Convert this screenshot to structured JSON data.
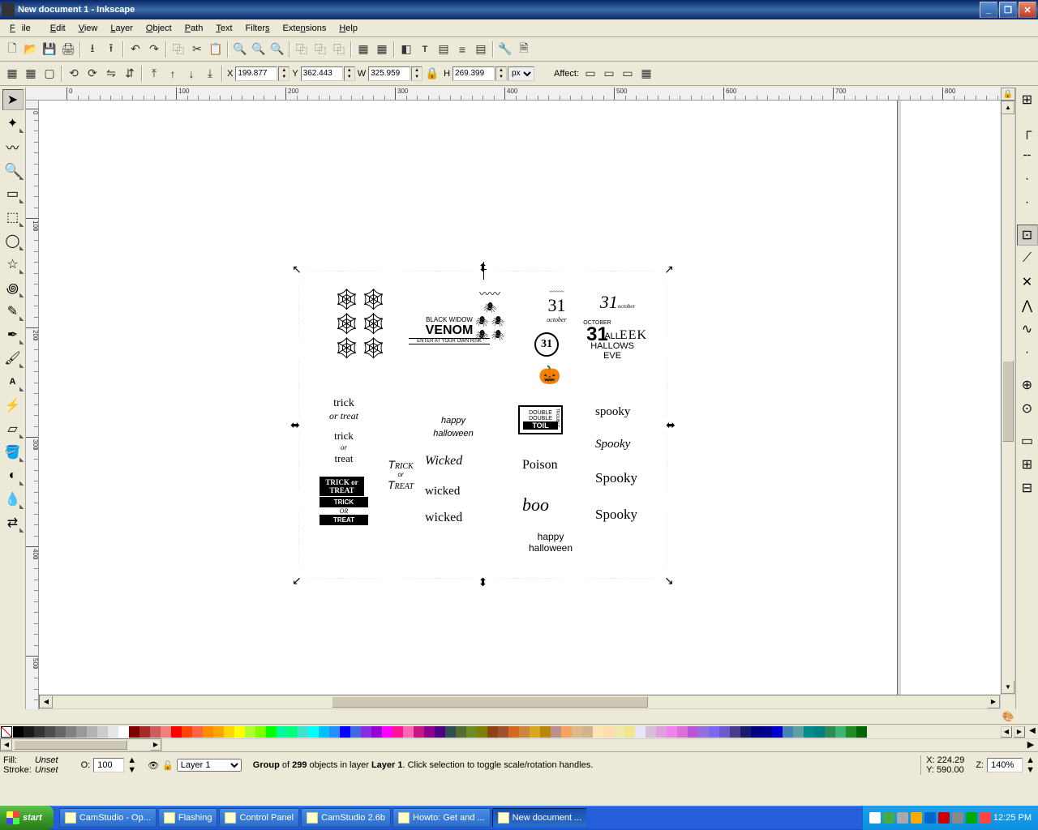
{
  "window": {
    "title": "New document 1 - Inkscape"
  },
  "menu": {
    "file": "File",
    "edit": "Edit",
    "view": "View",
    "layer": "Layer",
    "object": "Object",
    "path": "Path",
    "text": "Text",
    "filters": "Filters",
    "extensions": "Extensions",
    "help": "Help"
  },
  "coords": {
    "x_label": "X",
    "x": "199.877",
    "y_label": "Y",
    "y": "362.443",
    "w_label": "W",
    "w": "325.959",
    "h_label": "H",
    "h": "269.399",
    "unit": "px",
    "affect_label": "Affect:"
  },
  "canvas_art": {
    "venom1": "BLACK WIDOW",
    "venom2": "VENOM",
    "venom3": "ENTER AT YOUR OWN RISK",
    "oct31_1": "31",
    "oct31_s": "october",
    "oct_lbl": "OCTOBER",
    "oct_31": "31",
    "oct_all": "ALL",
    "oct_hall": "HALLOWS",
    "oct_eve": "EVE",
    "eek": "EEK",
    "c31": "31",
    "tt1a": "trick",
    "tt1b": "or treat",
    "tt2a": "trick",
    "tt2b": "or",
    "tt2c": "treat",
    "tt3": "TRICK or TREAT",
    "tt4": "TRICK or TREAT",
    "tt5a": "TRICK",
    "tt5b": "OR",
    "tt5c": "TREAT",
    "hh1": "happy",
    "hh2": "halloween",
    "wicked1": "Wicked",
    "wicked2": "wicked",
    "wicked3": "wicked",
    "ddt1": "DOUBLE",
    "ddt2": "DOUBLE",
    "ddt3": "TOIL",
    "ddt4": "TROUBLE",
    "poison": "Poison",
    "boo": "boo",
    "hh3": "happy",
    "hh4": "halloween",
    "spooky1": "spooky",
    "spooky2": "Spooky",
    "spooky3": "Spooky",
    "spooky4": "Spooky"
  },
  "palette": [
    "#000000",
    "#1a1a1a",
    "#333333",
    "#4d4d4d",
    "#666666",
    "#808080",
    "#999999",
    "#b3b3b3",
    "#cccccc",
    "#e6e6e6",
    "#ffffff",
    "#800000",
    "#a52a2a",
    "#cd5c5c",
    "#f08080",
    "#ff0000",
    "#ff4500",
    "#ff6347",
    "#ff8c00",
    "#ffa500",
    "#ffd700",
    "#ffff00",
    "#adff2f",
    "#7fff00",
    "#00ff00",
    "#00fa9a",
    "#00ff7f",
    "#40e0d0",
    "#00ffff",
    "#00bfff",
    "#1e90ff",
    "#0000ff",
    "#4169e1",
    "#8a2be2",
    "#9400d3",
    "#ff00ff",
    "#ff1493",
    "#ff69b4",
    "#c71585",
    "#8b008b",
    "#4b0082",
    "#2f4f4f",
    "#556b2f",
    "#6b8e23",
    "#808000",
    "#8b4513",
    "#a0522d",
    "#d2691e",
    "#cd853f",
    "#daa520",
    "#b8860b",
    "#bc8f8f",
    "#f4a460",
    "#deb887",
    "#d2b48c",
    "#ffe4b5",
    "#ffdead",
    "#eee8aa",
    "#f0e68c",
    "#e6e6fa",
    "#d8bfd8",
    "#dda0dd",
    "#ee82ee",
    "#da70d6",
    "#ba55d3",
    "#9370db",
    "#7b68ee",
    "#6a5acd",
    "#483d8b",
    "#191970",
    "#000080",
    "#00008b",
    "#0000cd",
    "#4682b4",
    "#5f9ea0",
    "#008b8b",
    "#008080",
    "#2e8b57",
    "#3cb371",
    "#228b22",
    "#006400"
  ],
  "status": {
    "fill_label": "Fill:",
    "fill_value": "Unset",
    "stroke_label": "Stroke:",
    "stroke_value": "Unset",
    "opacity_label": "O:",
    "opacity_value": "100",
    "layer_name": "Layer 1",
    "message": "Group of 299 objects in layer Layer 1. Click selection to toggle scale/rotation handles.",
    "msg_pre": "Group",
    "msg_of": " of ",
    "msg_count": "299",
    "msg_mid": " objects in layer ",
    "msg_layer": "Layer 1",
    "msg_post": ". Click selection to toggle scale/rotation handles.",
    "cursor_x_label": "X:",
    "cursor_x": "224.29",
    "cursor_y_label": "Y:",
    "cursor_y": "590.00",
    "zoom_label": "Z:",
    "zoom": "140%"
  },
  "taskbar": {
    "start": "start",
    "items": [
      {
        "label": "CamStudio - Op..."
      },
      {
        "label": "Flashing"
      },
      {
        "label": "Control Panel"
      },
      {
        "label": "CamStudio 2.6b"
      },
      {
        "label": "Howto: Get and ..."
      },
      {
        "label": "New document ..."
      }
    ],
    "clock": "12:25 PM"
  }
}
